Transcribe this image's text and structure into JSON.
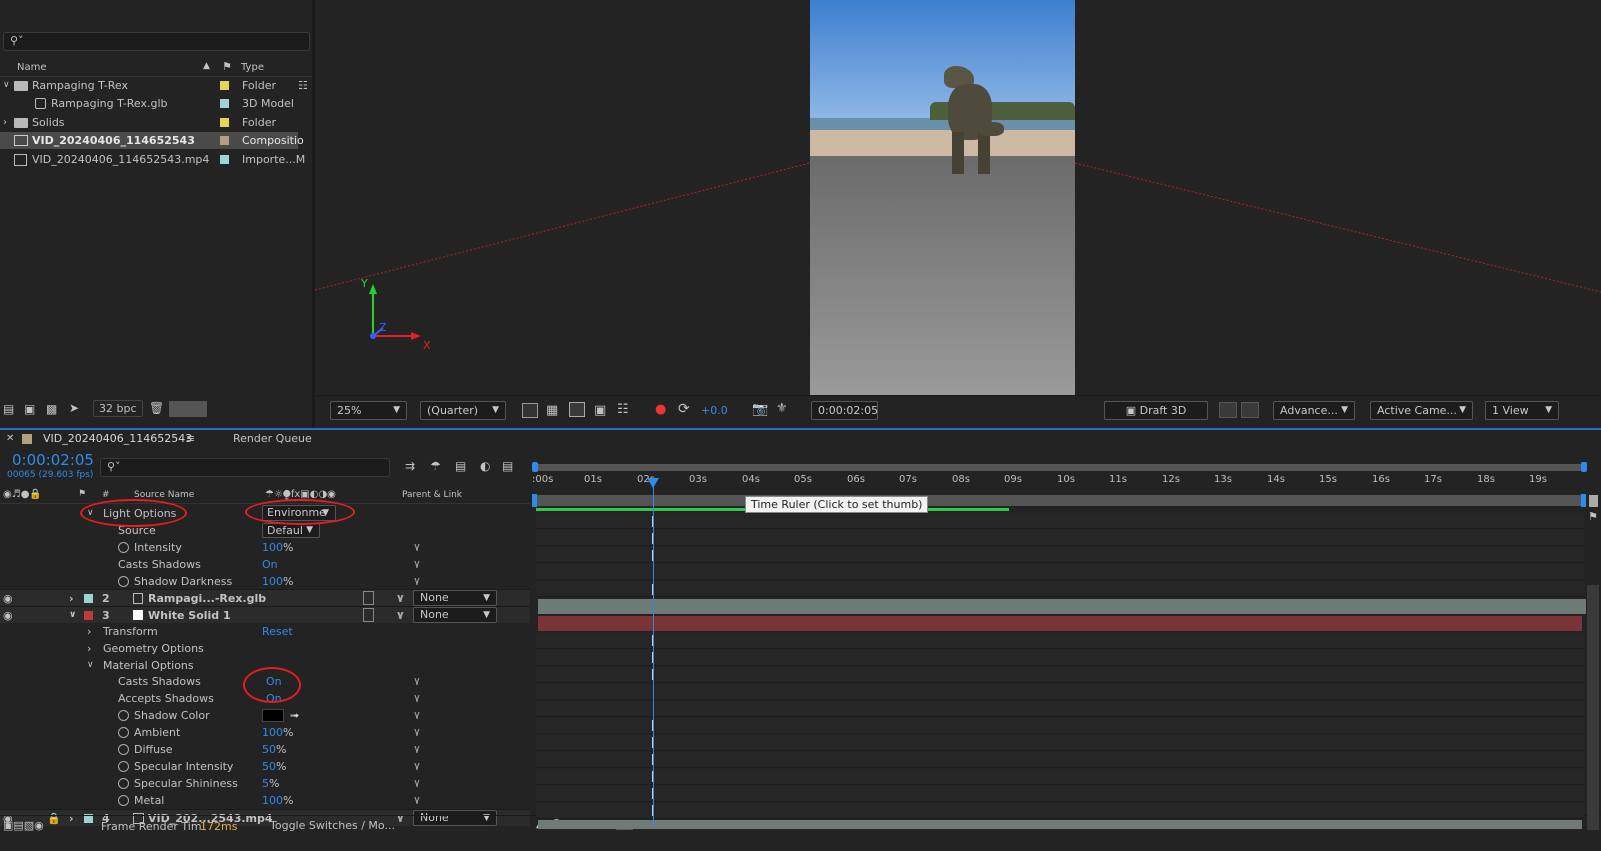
{
  "project": {
    "search_placeholder": "",
    "headers": {
      "name": "Name",
      "type": "Type"
    },
    "items": [
      {
        "name": "Rampaging T-Rex",
        "type": "Folder",
        "color": "#e8d44d"
      },
      {
        "name": "Rampaging T-Rex.glb",
        "type": "3D Model",
        "color": "#9fd3d3"
      },
      {
        "name": "Solids",
        "type": "Folder",
        "color": "#e8d44d"
      },
      {
        "name": "VID_20240406_114652543",
        "type": "Compositio",
        "color": "#b69f7d"
      },
      {
        "name": "VID_20240406_114652543.mp4",
        "type": "Importe...M",
        "color": "#9fd3d3"
      }
    ],
    "bpc": "32 bpc"
  },
  "viewer": {
    "zoom": "25%",
    "resolution": "(Quarter)",
    "exposure": "+0.0",
    "timecode": "0:00:02:05",
    "renderer": "Draft 3D",
    "view_mode": "Advance...",
    "camera": "Active Came...",
    "views": "1 View",
    "axis": {
      "x": "X",
      "y": "Y",
      "z": "Z"
    }
  },
  "timeline": {
    "comp_tab": "VID_20240406_114652543",
    "render_tab": "Render Queue",
    "time": "0:00:02:05",
    "frame": "00065 (29.603 fps)",
    "col_num": "#",
    "col_source": "Source Name",
    "col_parent": "Parent & Link",
    "ticks": [
      ":00s",
      "01s",
      "02s",
      "03s",
      "04s",
      "05s",
      "06s",
      "07s",
      "08s",
      "09s",
      "10s",
      "11s",
      "12s",
      "13s",
      "14s",
      "15s",
      "16s",
      "17s",
      "18s",
      "19s"
    ],
    "tooltip": "Time Ruler (Click to set thumb)",
    "light": {
      "label": "Light Options",
      "dropdown": "Environme",
      "source_label": "Source",
      "source_value": "Defaul",
      "props": [
        {
          "name": "Intensity",
          "value": "100",
          "unit": "%"
        },
        {
          "name": "Casts Shadows",
          "value": "On",
          "unit": ""
        },
        {
          "name": "Shadow Darkness",
          "value": "100",
          "unit": "%"
        }
      ]
    },
    "layers": [
      {
        "num": "2",
        "name": "Rampagi...-Rex.glb",
        "parent": "None",
        "color": "#9fd3d3"
      },
      {
        "num": "3",
        "name": "White Solid 1",
        "parent": "None",
        "color": "#c0393b"
      },
      {
        "num": "4",
        "name": "VID_202...2543.mp4",
        "parent": "None",
        "color": "#9fd3d3"
      }
    ],
    "groups": {
      "transform": "Transform",
      "reset": "Reset",
      "geometry": "Geometry Options",
      "material": "Material Options"
    },
    "material": [
      {
        "name": "Casts Shadows",
        "value": "On",
        "unit": ""
      },
      {
        "name": "Accepts Shadows",
        "value": "On",
        "unit": ""
      },
      {
        "name": "Shadow Color",
        "value": "",
        "unit": ""
      },
      {
        "name": "Ambient",
        "value": "100",
        "unit": "%"
      },
      {
        "name": "Diffuse",
        "value": "50",
        "unit": "%"
      },
      {
        "name": "Specular Intensity",
        "value": "50",
        "unit": "%"
      },
      {
        "name": "Specular Shininess",
        "value": "5",
        "unit": "%"
      },
      {
        "name": "Metal",
        "value": "100",
        "unit": "%"
      }
    ],
    "footer": {
      "frame_render": "Frame Render Tim",
      "ms": "172ms",
      "toggle": "Toggle Switches / Mo..."
    }
  }
}
